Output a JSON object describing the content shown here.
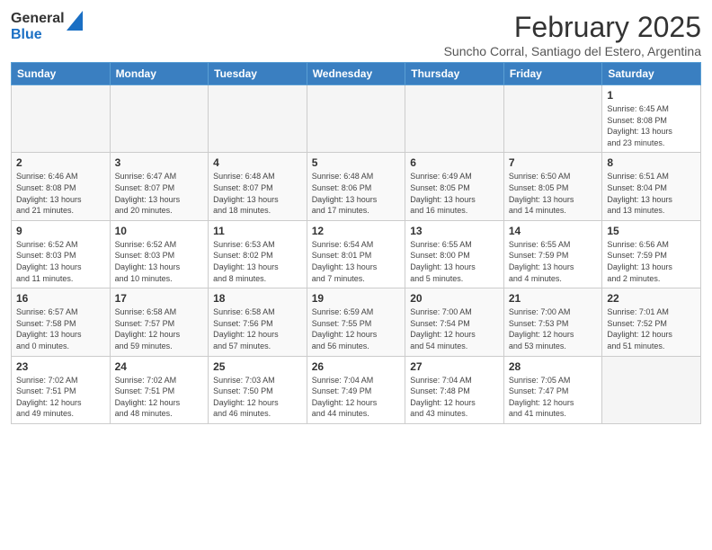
{
  "header": {
    "logo_general": "General",
    "logo_blue": "Blue",
    "month_title": "February 2025",
    "subtitle": "Suncho Corral, Santiago del Estero, Argentina"
  },
  "weekdays": [
    "Sunday",
    "Monday",
    "Tuesday",
    "Wednesday",
    "Thursday",
    "Friday",
    "Saturday"
  ],
  "weeks": [
    [
      {
        "day": "",
        "info": ""
      },
      {
        "day": "",
        "info": ""
      },
      {
        "day": "",
        "info": ""
      },
      {
        "day": "",
        "info": ""
      },
      {
        "day": "",
        "info": ""
      },
      {
        "day": "",
        "info": ""
      },
      {
        "day": "1",
        "info": "Sunrise: 6:45 AM\nSunset: 8:08 PM\nDaylight: 13 hours\nand 23 minutes."
      }
    ],
    [
      {
        "day": "2",
        "info": "Sunrise: 6:46 AM\nSunset: 8:08 PM\nDaylight: 13 hours\nand 21 minutes."
      },
      {
        "day": "3",
        "info": "Sunrise: 6:47 AM\nSunset: 8:07 PM\nDaylight: 13 hours\nand 20 minutes."
      },
      {
        "day": "4",
        "info": "Sunrise: 6:48 AM\nSunset: 8:07 PM\nDaylight: 13 hours\nand 18 minutes."
      },
      {
        "day": "5",
        "info": "Sunrise: 6:48 AM\nSunset: 8:06 PM\nDaylight: 13 hours\nand 17 minutes."
      },
      {
        "day": "6",
        "info": "Sunrise: 6:49 AM\nSunset: 8:05 PM\nDaylight: 13 hours\nand 16 minutes."
      },
      {
        "day": "7",
        "info": "Sunrise: 6:50 AM\nSunset: 8:05 PM\nDaylight: 13 hours\nand 14 minutes."
      },
      {
        "day": "8",
        "info": "Sunrise: 6:51 AM\nSunset: 8:04 PM\nDaylight: 13 hours\nand 13 minutes."
      }
    ],
    [
      {
        "day": "9",
        "info": "Sunrise: 6:52 AM\nSunset: 8:03 PM\nDaylight: 13 hours\nand 11 minutes."
      },
      {
        "day": "10",
        "info": "Sunrise: 6:52 AM\nSunset: 8:03 PM\nDaylight: 13 hours\nand 10 minutes."
      },
      {
        "day": "11",
        "info": "Sunrise: 6:53 AM\nSunset: 8:02 PM\nDaylight: 13 hours\nand 8 minutes."
      },
      {
        "day": "12",
        "info": "Sunrise: 6:54 AM\nSunset: 8:01 PM\nDaylight: 13 hours\nand 7 minutes."
      },
      {
        "day": "13",
        "info": "Sunrise: 6:55 AM\nSunset: 8:00 PM\nDaylight: 13 hours\nand 5 minutes."
      },
      {
        "day": "14",
        "info": "Sunrise: 6:55 AM\nSunset: 7:59 PM\nDaylight: 13 hours\nand 4 minutes."
      },
      {
        "day": "15",
        "info": "Sunrise: 6:56 AM\nSunset: 7:59 PM\nDaylight: 13 hours\nand 2 minutes."
      }
    ],
    [
      {
        "day": "16",
        "info": "Sunrise: 6:57 AM\nSunset: 7:58 PM\nDaylight: 13 hours\nand 0 minutes."
      },
      {
        "day": "17",
        "info": "Sunrise: 6:58 AM\nSunset: 7:57 PM\nDaylight: 12 hours\nand 59 minutes."
      },
      {
        "day": "18",
        "info": "Sunrise: 6:58 AM\nSunset: 7:56 PM\nDaylight: 12 hours\nand 57 minutes."
      },
      {
        "day": "19",
        "info": "Sunrise: 6:59 AM\nSunset: 7:55 PM\nDaylight: 12 hours\nand 56 minutes."
      },
      {
        "day": "20",
        "info": "Sunrise: 7:00 AM\nSunset: 7:54 PM\nDaylight: 12 hours\nand 54 minutes."
      },
      {
        "day": "21",
        "info": "Sunrise: 7:00 AM\nSunset: 7:53 PM\nDaylight: 12 hours\nand 53 minutes."
      },
      {
        "day": "22",
        "info": "Sunrise: 7:01 AM\nSunset: 7:52 PM\nDaylight: 12 hours\nand 51 minutes."
      }
    ],
    [
      {
        "day": "23",
        "info": "Sunrise: 7:02 AM\nSunset: 7:51 PM\nDaylight: 12 hours\nand 49 minutes."
      },
      {
        "day": "24",
        "info": "Sunrise: 7:02 AM\nSunset: 7:51 PM\nDaylight: 12 hours\nand 48 minutes."
      },
      {
        "day": "25",
        "info": "Sunrise: 7:03 AM\nSunset: 7:50 PM\nDaylight: 12 hours\nand 46 minutes."
      },
      {
        "day": "26",
        "info": "Sunrise: 7:04 AM\nSunset: 7:49 PM\nDaylight: 12 hours\nand 44 minutes."
      },
      {
        "day": "27",
        "info": "Sunrise: 7:04 AM\nSunset: 7:48 PM\nDaylight: 12 hours\nand 43 minutes."
      },
      {
        "day": "28",
        "info": "Sunrise: 7:05 AM\nSunset: 7:47 PM\nDaylight: 12 hours\nand 41 minutes."
      },
      {
        "day": "",
        "info": ""
      }
    ]
  ]
}
